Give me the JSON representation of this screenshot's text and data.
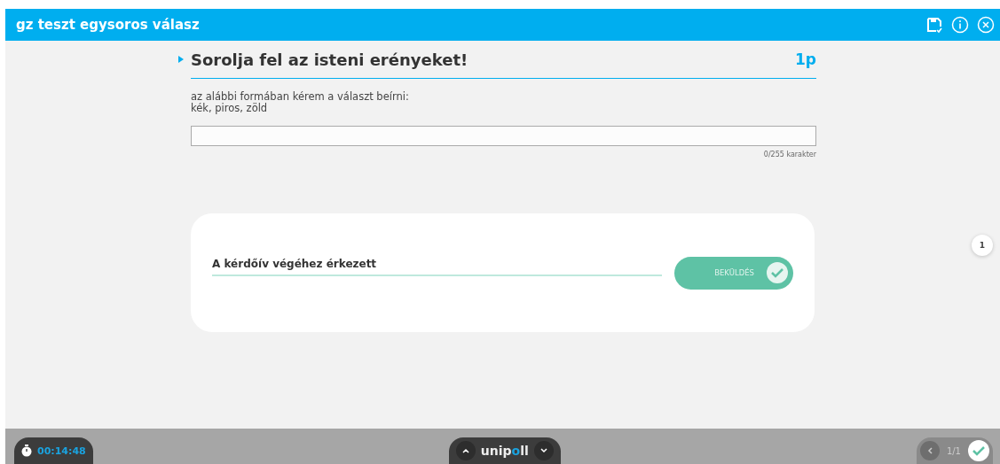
{
  "window": {
    "title": "gz teszt egysoros válasz"
  },
  "question": {
    "title": "Sorolja fel az isteni erényeket!",
    "points": "1p",
    "instructions": "az alábbi formában kérem a választ beírni:\nkék, piros, zöld",
    "answer": {
      "counter": "0/255 karakter"
    }
  },
  "submit_card": {
    "message": "A kérdőív végéhez érkezett",
    "button": "BEKÜLDÉS"
  },
  "side_marker": "1",
  "footer": {
    "timer": "00:14:48",
    "logo": "unipoll",
    "page": "1/1"
  }
}
